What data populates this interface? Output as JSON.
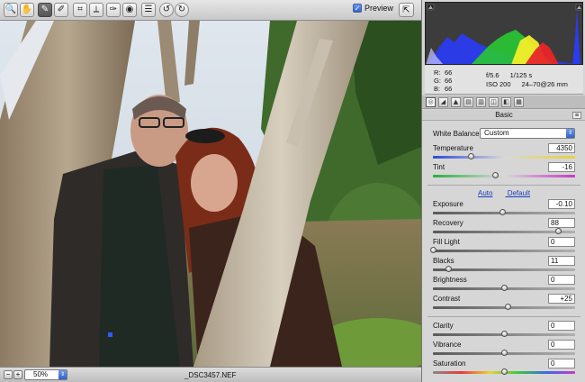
{
  "toolbar": {
    "tools": [
      {
        "icon": "zoom-icon",
        "glyph": "🔍"
      },
      {
        "icon": "hand-icon",
        "glyph": "✋"
      },
      {
        "icon": "white-balance-icon",
        "glyph": "✎"
      },
      {
        "icon": "color-sampler-icon",
        "glyph": "✐"
      },
      {
        "icon": "crop-icon",
        "glyph": "⌗"
      },
      {
        "icon": "straighten-icon",
        "glyph": "⟂"
      },
      {
        "icon": "retouch-icon",
        "glyph": "✑"
      },
      {
        "icon": "red-eye-icon",
        "glyph": "◉"
      },
      {
        "icon": "preferences-icon",
        "glyph": "☰"
      },
      {
        "icon": "rotate-left-icon",
        "glyph": "↺"
      },
      {
        "icon": "rotate-right-icon",
        "glyph": "↻"
      }
    ],
    "preview_label": "Preview",
    "preview_checked": true
  },
  "status": {
    "zoom_value": "50%",
    "filename": "_DSC3457.NEF"
  },
  "readout": {
    "r_label": "R:",
    "r_value": "66",
    "g_label": "G:",
    "g_value": "66",
    "b_label": "B:",
    "b_value": "66",
    "aperture": "f/5.6",
    "shutter": "1/125 s",
    "iso": "ISO 200",
    "lens": "24–70@26 mm"
  },
  "tabs": [
    {
      "icon": "basic-tab-icon",
      "glyph": "◎"
    },
    {
      "icon": "tone-curve-tab-icon",
      "glyph": "◢"
    },
    {
      "icon": "detail-tab-icon",
      "glyph": "▲"
    },
    {
      "icon": "hsl-tab-icon",
      "glyph": "▤"
    },
    {
      "icon": "split-toning-tab-icon",
      "glyph": "▥"
    },
    {
      "icon": "lens-tab-icon",
      "glyph": "◫"
    },
    {
      "icon": "camera-calibration-tab-icon",
      "glyph": "◧"
    },
    {
      "icon": "presets-tab-icon",
      "glyph": "▦"
    }
  ],
  "basic": {
    "section_title": "Basic",
    "white_balance_label": "White Balance:",
    "white_balance_value": "Custom",
    "auto_label": "Auto",
    "default_label": "Default",
    "sliders": [
      {
        "key": "temperature",
        "label": "Temperature",
        "value": "4350",
        "pos": 0.27,
        "track": "temp"
      },
      {
        "key": "tint",
        "label": "Tint",
        "value": "-16",
        "pos": 0.44,
        "track": "tint"
      },
      {
        "key": "exposure",
        "label": "Exposure",
        "value": "-0.10",
        "pos": 0.49,
        "track": "gray"
      },
      {
        "key": "recovery",
        "label": "Recovery",
        "value": "88",
        "pos": 0.88,
        "track": "gray"
      },
      {
        "key": "fill-light",
        "label": "Fill Light",
        "value": "0",
        "pos": 0.0,
        "track": "gray"
      },
      {
        "key": "blacks",
        "label": "Blacks",
        "value": "11",
        "pos": 0.11,
        "track": "gray"
      },
      {
        "key": "brightness",
        "label": "Brightness",
        "value": "0",
        "pos": 0.5,
        "track": "gray"
      },
      {
        "key": "contrast",
        "label": "Contrast",
        "value": "+25",
        "pos": 0.53,
        "track": "gray"
      },
      {
        "key": "clarity",
        "label": "Clarity",
        "value": "0",
        "pos": 0.5,
        "track": "gray"
      },
      {
        "key": "vibrance",
        "label": "Vibrance",
        "value": "0",
        "pos": 0.5,
        "track": "gray"
      },
      {
        "key": "saturation",
        "label": "Saturation",
        "value": "0",
        "pos": 0.5,
        "track": "sat"
      }
    ]
  },
  "colors": {
    "hist_red": "#e8262a",
    "hist_green": "#28c832",
    "hist_blue": "#2a3cf0",
    "hist_yellow": "#f2ee2a",
    "link": "#1a3fbf"
  }
}
